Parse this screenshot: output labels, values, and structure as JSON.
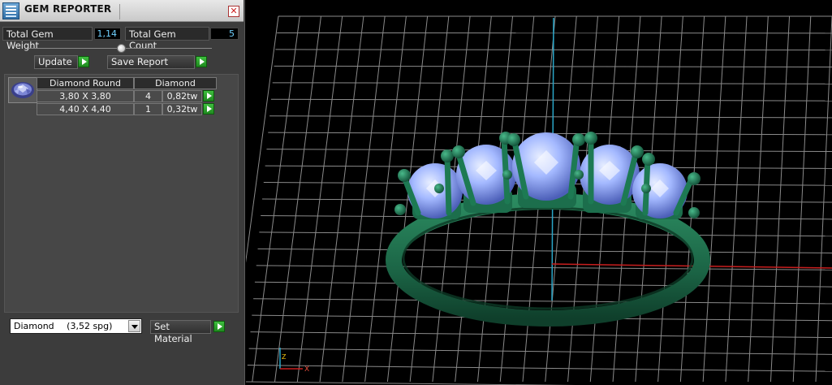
{
  "window": {
    "title": "GEM REPORTER"
  },
  "stats": {
    "total_gem_weight_label": "Total Gem Weight",
    "total_gem_weight_value": "1,14",
    "total_gem_count_label": "Total Gem Count",
    "total_gem_count_value": "5"
  },
  "toolbar": {
    "update_label": "Update",
    "save_report_label": "Save Report"
  },
  "gem_table": {
    "headers": [
      "Diamond Round",
      "Diamond"
    ],
    "rows": [
      {
        "size": "3,80 X 3,80",
        "count": "4",
        "weight": "0,82tw"
      },
      {
        "size": "4,40 X 4,40",
        "count": "1",
        "weight": "0,32tw"
      }
    ]
  },
  "material": {
    "selected": "Diamond",
    "spg": "(3,52 spg)",
    "set_material_label": "Set Material"
  },
  "viewport": {
    "axis_labels": {
      "z": "Z",
      "x": "X"
    },
    "colors": {
      "metal": "#1e6b4a",
      "gem": "#9fb7ff",
      "grid": "#8a8a8a",
      "x_axis": "#c81e1e",
      "y_axis": "#2aa6c8"
    }
  },
  "icons": [
    "app-icon",
    "close-icon",
    "gem-thumbnail-icon",
    "play-arrow-icon",
    "chevron-down-icon",
    "axis-triad-icon"
  ]
}
